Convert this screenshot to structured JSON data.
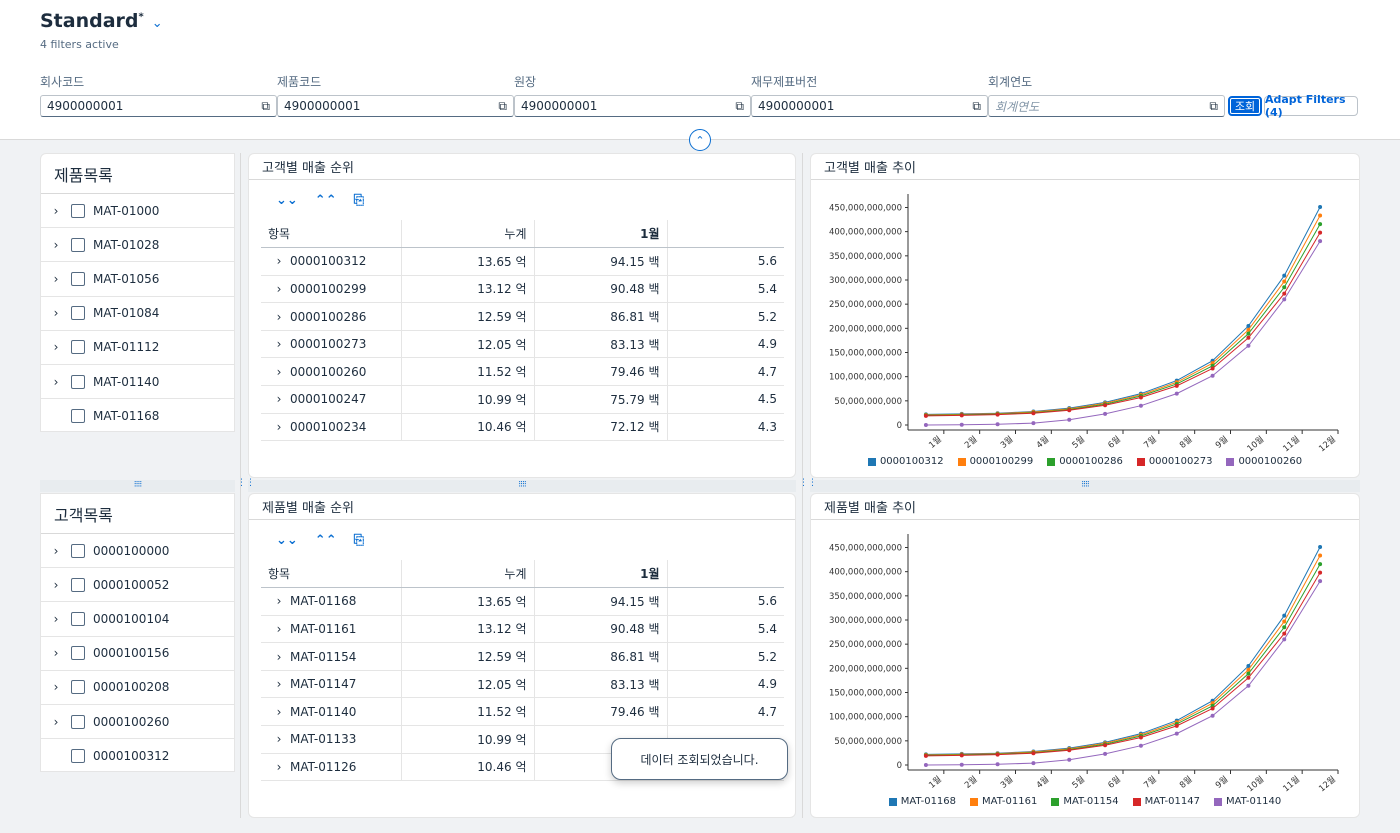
{
  "header": {
    "variant_title": "Standard",
    "variant_modified_mark": "*",
    "filters_active": "4 filters active",
    "filters": [
      {
        "label": "회사코드",
        "value": "4900000001",
        "placeholder": ""
      },
      {
        "label": "제품코드",
        "value": "4900000001",
        "placeholder": ""
      },
      {
        "label": "원장",
        "value": "4900000001",
        "placeholder": ""
      },
      {
        "label": "재무제표버전",
        "value": "4900000001",
        "placeholder": ""
      },
      {
        "label": "회계연도",
        "value": "",
        "placeholder": "회계연도"
      }
    ],
    "go_label": "조회",
    "adapt_filters_label": "Adapt Filters (4)"
  },
  "product_list": {
    "title": "제품목록",
    "items": [
      "MAT-01000",
      "MAT-01028",
      "MAT-01056",
      "MAT-01084",
      "MAT-01112",
      "MAT-01140",
      "MAT-01168"
    ]
  },
  "customer_list": {
    "title": "고객목록",
    "items": [
      "0000100000",
      "0000100052",
      "0000100104",
      "0000100156",
      "0000100208",
      "0000100260",
      "0000100312"
    ]
  },
  "customer_ranking": {
    "title": "고객별 매출 순위",
    "columns": [
      "항목",
      "누계",
      "1월"
    ],
    "rows": [
      {
        "item": "0000100312",
        "total": "13.65 억",
        "m1": "94.15 백",
        "m2": "5.6"
      },
      {
        "item": "0000100299",
        "total": "13.12 억",
        "m1": "90.48 백",
        "m2": "5.4"
      },
      {
        "item": "0000100286",
        "total": "12.59 억",
        "m1": "86.81 백",
        "m2": "5.2"
      },
      {
        "item": "0000100273",
        "total": "12.05 억",
        "m1": "83.13 백",
        "m2": "4.9"
      },
      {
        "item": "0000100260",
        "total": "11.52 억",
        "m1": "79.46 백",
        "m2": "4.7"
      },
      {
        "item": "0000100247",
        "total": "10.99 억",
        "m1": "75.79 백",
        "m2": "4.5"
      },
      {
        "item": "0000100234",
        "total": "10.46 억",
        "m1": "72.12 백",
        "m2": "4.3"
      }
    ]
  },
  "product_ranking": {
    "title": "제품별 매출 순위",
    "columns": [
      "항목",
      "누계",
      "1월"
    ],
    "rows": [
      {
        "item": "MAT-01168",
        "total": "13.65 억",
        "m1": "94.15 백",
        "m2": "5.6"
      },
      {
        "item": "MAT-01161",
        "total": "13.12 억",
        "m1": "90.48 백",
        "m2": "5.4"
      },
      {
        "item": "MAT-01154",
        "total": "12.59 억",
        "m1": "86.81 백",
        "m2": "5.2"
      },
      {
        "item": "MAT-01147",
        "total": "12.05 억",
        "m1": "83.13 백",
        "m2": "4.9"
      },
      {
        "item": "MAT-01140",
        "total": "11.52 억",
        "m1": "79.46 백",
        "m2": "4.7"
      },
      {
        "item": "MAT-01133",
        "total": "10.99 억",
        "m1": "",
        "m2": ""
      },
      {
        "item": "MAT-01126",
        "total": "10.46 억",
        "m1": "",
        "m2": ""
      }
    ]
  },
  "toast": "데이터 조회되었습니다.",
  "chart_data": [
    {
      "type": "line",
      "title": "고객별 매출 추이",
      "x": [
        "1월",
        "2월",
        "3월",
        "4월",
        "5월",
        "6월",
        "7월",
        "8월",
        "9월",
        "10월",
        "11월",
        "12월"
      ],
      "yticks": [
        "0",
        "50,000,000,000",
        "100,000,000,000",
        "150,000,000,000",
        "200,000,000,000",
        "250,000,000,000",
        "300,000,000,000",
        "350,000,000,000",
        "400,000,000,000",
        "450,000,000,000"
      ],
      "ylim": [
        0,
        480000000000
      ],
      "legend_position": "bottom",
      "series": [
        {
          "name": "0000100312",
          "color": "#1f77b4",
          "values": [
            24000000000,
            25000000000,
            26500000000,
            30000000000,
            37000000000,
            49000000000,
            67000000000,
            94000000000,
            135000000000,
            207000000000,
            311000000000,
            453117126000
          ]
        },
        {
          "name": "0000100299",
          "color": "#ff7f0e",
          "values": [
            23000000000,
            24000000000,
            25500000000,
            29000000000,
            35500000000,
            47000000000,
            64500000000,
            90500000000,
            130000000000,
            199000000000,
            299000000000,
            435446707000
          ]
        },
        {
          "name": "0000100286",
          "color": "#2ca02c",
          "values": [
            22000000000,
            23000000000,
            24500000000,
            27500000000,
            34000000000,
            45000000000,
            62000000000,
            87000000000,
            124500000000,
            191000000000,
            287000000000,
            417763615000
          ]
        },
        {
          "name": "0000100273",
          "color": "#d62728",
          "values": [
            21000000000,
            22000000000,
            23500000000,
            26500000000,
            32500000000,
            43000000000,
            59000000000,
            83000000000,
            119000000000,
            182500000000,
            274000000000,
            400086602000
          ]
        },
        {
          "name": "0000100260",
          "color": "#9467bd",
          "values": [
            2000000000,
            2500000000,
            3500000000,
            6000000000,
            13000000000,
            25000000000,
            42000000000,
            67000000000,
            104000000000,
            166000000000,
            262000000000,
            382410500000
          ]
        }
      ]
    },
    {
      "type": "line",
      "title": "제품별 매출 추이",
      "x": [
        "1월",
        "2월",
        "3월",
        "4월",
        "5월",
        "6월",
        "7월",
        "8월",
        "9월",
        "10월",
        "11월",
        "12월"
      ],
      "yticks": [
        "0",
        "50,000,000,000",
        "100,000,000,000",
        "150,000,000,000",
        "200,000,000,000",
        "250,000,000,000",
        "300,000,000,000",
        "350,000,000,000",
        "400,000,000,000",
        "450,000,000,000"
      ],
      "ylim": [
        0,
        480000000000
      ],
      "legend_position": "bottom",
      "series": [
        {
          "name": "MAT-01168",
          "color": "#1f77b4",
          "values": [
            24000000000,
            25000000000,
            26500000000,
            30000000000,
            37000000000,
            49000000000,
            67000000000,
            94000000000,
            135000000000,
            207000000000,
            311000000000,
            453117126000
          ]
        },
        {
          "name": "MAT-01161",
          "color": "#ff7f0e",
          "values": [
            23000000000,
            24000000000,
            25500000000,
            29000000000,
            35500000000,
            47000000000,
            64500000000,
            90500000000,
            130000000000,
            199000000000,
            299000000000,
            435446707000
          ]
        },
        {
          "name": "MAT-01154",
          "color": "#2ca02c",
          "values": [
            22000000000,
            23000000000,
            24500000000,
            27500000000,
            34000000000,
            45000000000,
            62000000000,
            87000000000,
            124500000000,
            191000000000,
            287000000000,
            417763615000
          ]
        },
        {
          "name": "MAT-01147",
          "color": "#d62728",
          "values": [
            21000000000,
            22000000000,
            23500000000,
            26500000000,
            32500000000,
            43000000000,
            59000000000,
            83000000000,
            119000000000,
            182500000000,
            274000000000,
            400086602000
          ]
        },
        {
          "name": "MAT-01140",
          "color": "#9467bd",
          "values": [
            2000000000,
            2500000000,
            3500000000,
            6000000000,
            13000000000,
            25000000000,
            42000000000,
            67000000000,
            104000000000,
            166000000000,
            262000000000,
            382410500000
          ]
        }
      ]
    }
  ]
}
